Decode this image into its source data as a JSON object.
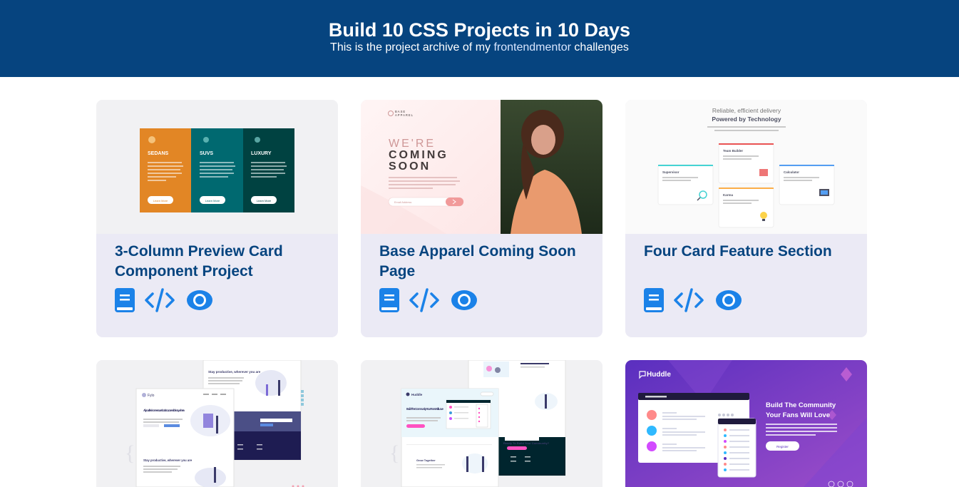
{
  "header": {
    "title": "Build 10 CSS Projects in 10 Days",
    "subtitle_prefix": "This is the project archive of my ",
    "subtitle_link": "frontendmentor",
    "subtitle_suffix": " challenges"
  },
  "colors": {
    "header_bg": "#06447f",
    "card_bg": "#ebeaf5",
    "title_color": "#06447f",
    "icon_color": "#1b82e8"
  },
  "icons": [
    "book-icon",
    "code-icon",
    "eye-icon"
  ],
  "projects": [
    {
      "title": "3-Column Preview Card Component Project",
      "preview": {
        "columns": [
          {
            "heading": "SEDANS",
            "color": "#e28625",
            "button": "Learn More"
          },
          {
            "heading": "SUVS",
            "color": "#006970",
            "button": "Learn More"
          },
          {
            "heading": "LUXURY",
            "color": "#004241",
            "button": "Learn More"
          }
        ]
      }
    },
    {
      "title": "Base Apparel Coming Soon Page",
      "preview": {
        "brand_line1": "BASE",
        "brand_line2": "APPAREL",
        "headline_1": "WE'RE",
        "headline_2": "COMING",
        "headline_3": "SOON",
        "email_placeholder": "Email Address"
      }
    },
    {
      "title": "Four Card Feature Section",
      "preview": {
        "tagline": "Reliable, efficient delivery",
        "heading": "Powered by Technology",
        "cards": [
          "Supervisor",
          "Team Builder",
          "Karma",
          "Calculator"
        ]
      }
    },
    {
      "title": "",
      "preview": {
        "brand": "Fylo",
        "hero": "All your files in one secure location, accessible anywhere.",
        "section": "Stay productive, wherever you are"
      }
    },
    {
      "title": "",
      "preview": {
        "brand": "Huddle",
        "hero": "Build The Community Your Fans Will Love",
        "cta": "Ready To Build Your Community?"
      }
    },
    {
      "title": "",
      "preview": {
        "brand": "Huddle",
        "hero_line1": "Build The Community",
        "hero_line2": "Your Fans Will Love",
        "button": "Register"
      }
    }
  ]
}
